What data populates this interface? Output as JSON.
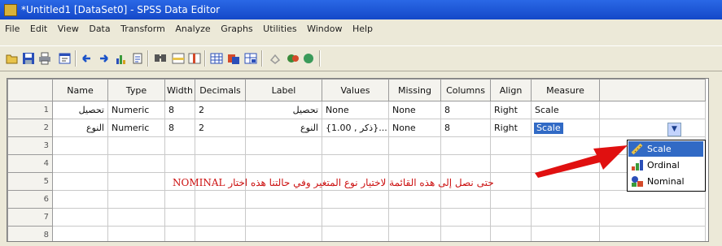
{
  "window": {
    "title": "*Untitled1 [DataSet0] - SPSS Data Editor"
  },
  "menu": [
    "File",
    "Edit",
    "View",
    "Data",
    "Transform",
    "Analyze",
    "Graphs",
    "Utilities",
    "Window",
    "Help"
  ],
  "toolbar_icons": [
    "open-icon",
    "save-icon",
    "print-icon",
    "dialog-recall-icon",
    "undo-icon",
    "redo-icon",
    "goto-chart-icon",
    "goto-case-icon",
    "find-icon",
    "insert-cases-icon",
    "insert-variable-icon",
    "split-file-icon",
    "weight-cases-icon",
    "select-cases-icon",
    "value-labels-icon",
    "use-sets-icon",
    "show-all-icon"
  ],
  "grid": {
    "columns": [
      "Name",
      "Type",
      "Width",
      "Decimals",
      "Label",
      "Values",
      "Missing",
      "Columns",
      "Align",
      "Measure"
    ],
    "rows": [
      {
        "num": "1",
        "cells": [
          "تحصيل",
          "Numeric",
          "8",
          "2",
          "تحصيل",
          "None",
          "None",
          "8",
          "Right",
          "Scale"
        ]
      },
      {
        "num": "2",
        "cells": [
          "النوع",
          "Numeric",
          "8",
          "2",
          "النوع",
          "{1.00 , ذكر}...",
          "None",
          "8",
          "Right",
          "Scale"
        ]
      },
      {
        "num": "3",
        "cells": [
          "",
          "",
          "",
          "",
          "",
          "",
          "",
          "",
          "",
          ""
        ]
      },
      {
        "num": "4",
        "cells": [
          "",
          "",
          "",
          "",
          "",
          "",
          "",
          "",
          "",
          ""
        ]
      },
      {
        "num": "5",
        "cells": [
          "",
          "",
          "",
          "",
          "",
          "",
          "",
          "",
          "",
          ""
        ]
      },
      {
        "num": "6",
        "cells": [
          "",
          "",
          "",
          "",
          "",
          "",
          "",
          "",
          "",
          ""
        ]
      },
      {
        "num": "7",
        "cells": [
          "",
          "",
          "",
          "",
          "",
          "",
          "",
          "",
          "",
          ""
        ]
      },
      {
        "num": "8",
        "cells": [
          "",
          "",
          "",
          "",
          "",
          "",
          "",
          "",
          "",
          ""
        ]
      }
    ]
  },
  "measure_dropdown": {
    "arrow": "▼",
    "options": [
      {
        "label": "Scale",
        "icon": "ruler-icon",
        "selected": true
      },
      {
        "label": "Ordinal",
        "icon": "ordinal-bars-icon",
        "selected": false
      },
      {
        "label": "Nominal",
        "icon": "nominal-blocks-icon",
        "selected": false
      }
    ]
  },
  "annotation": {
    "text": "حتى نصل إلى هذه القائمة لاختيار نوع المتغير وفي حالتنا هذه اختار NOMINAL",
    "color": "#cc1111"
  },
  "colors": {
    "title_bar": "#1f5ad8",
    "selection": "#316ac5",
    "annotation": "#cc1111",
    "arrow": "#e01010"
  }
}
